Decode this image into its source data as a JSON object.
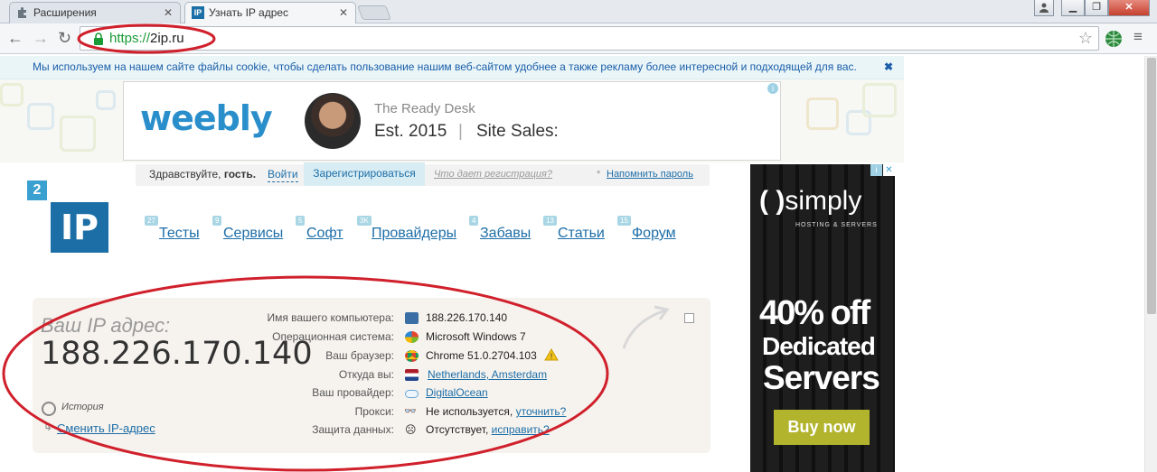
{
  "tabs": [
    {
      "title": "Расширения"
    },
    {
      "title": "Узнать IP адрес"
    }
  ],
  "address_bar": {
    "scheme": "https://",
    "host": "2ip.ru"
  },
  "cookie_notice": "Мы используем на нашем сайте файлы cookie, чтобы сделать пользование нашим веб-сайтом удобнее а также рекламу более интересной и подходящей для вас.",
  "top_ad": {
    "brand": "weebly",
    "line1": "The Ready Desk",
    "est": "Est. 2015",
    "sales": "Site Sales:"
  },
  "login": {
    "greeting": "Здравствуйте, ",
    "guest": "гость.",
    "login": "Войти",
    "register": "Зарегистрироваться",
    "why": "Что дает регистрация?",
    "remind": "Напомнить пароль"
  },
  "logo": {
    "small": "2",
    "big": "IP"
  },
  "nav": [
    {
      "label": "Тесты",
      "badge": "27"
    },
    {
      "label": "Сервисы",
      "badge": "9"
    },
    {
      "label": "Софт",
      "badge": "5"
    },
    {
      "label": "Провайдеры",
      "badge": "3K"
    },
    {
      "label": "Забавы",
      "badge": "4"
    },
    {
      "label": "Статьи",
      "badge": "13"
    },
    {
      "label": "Форум",
      "badge": "15"
    }
  ],
  "ip_panel": {
    "heading": "Ваш IP адрес:",
    "ip": "188.226.170.140",
    "history": "История",
    "change": "Сменить IP-адрес",
    "rows": [
      {
        "label": "Имя вашего компьютера:",
        "value": "188.226.170.140"
      },
      {
        "label": "Операционная система:",
        "value": "Microsoft Windows 7"
      },
      {
        "label": "Ваш браузер:",
        "value": "Chrome 51.0.2704.103"
      },
      {
        "label": "Откуда вы:",
        "value": "Netherlands, Amsterdam"
      },
      {
        "label": "Ваш провайдер:",
        "value": "DigitalOcean"
      },
      {
        "label": "Прокси:",
        "value": "Не используется, ",
        "link": "уточнить?"
      },
      {
        "label": "Защита данных:",
        "value": "Отсутствует, ",
        "link": "исправить?"
      }
    ]
  },
  "right_ad": {
    "brand": "simply",
    "sub": "HOSTING & SERVERS",
    "offer1": "40% off",
    "offer2": "Dedicated",
    "offer3": "Servers",
    "cta": "Buy now"
  },
  "colors": {
    "annotation": "#d0202c",
    "link": "#1d6ea8",
    "logo": "#1c6fa6"
  }
}
